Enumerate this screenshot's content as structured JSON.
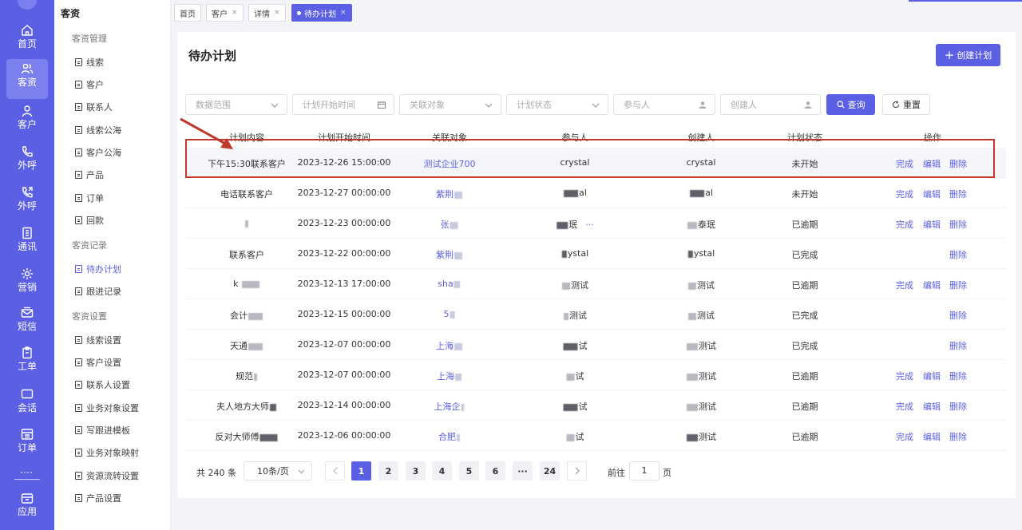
{
  "rail": {
    "items": [
      {
        "label": "首页",
        "icon": "home-icon"
      },
      {
        "label": "客资",
        "icon": "users-icon",
        "active": true
      },
      {
        "label": "客户",
        "icon": "person-icon"
      },
      {
        "label": "外呼",
        "icon": "phone-icon"
      },
      {
        "label": "外呼",
        "icon": "phone-out-icon"
      },
      {
        "label": "通讯",
        "icon": "address-book-icon"
      },
      {
        "label": "营销",
        "icon": "gear-icon"
      },
      {
        "label": "短信",
        "icon": "mail-icon"
      },
      {
        "label": "工单",
        "icon": "clipboard-icon"
      },
      {
        "label": "会话",
        "icon": "chat-icon"
      },
      {
        "label": "订单",
        "icon": "list-icon"
      },
      {
        "label": "应用",
        "icon": "app-icon"
      }
    ],
    "accent": "#5b5fe3"
  },
  "subnav": {
    "title": "客资",
    "groups": [
      {
        "label": "客资管理",
        "items": [
          "线索",
          "客户",
          "联系人",
          "线索公海",
          "客户公海",
          "产品",
          "订单",
          "回款"
        ]
      },
      {
        "label": "客资记录",
        "items": [
          "待办计划",
          "跟进记录"
        ]
      },
      {
        "label": "客资设置",
        "items": [
          "线索设置",
          "客户设置",
          "联系人设置",
          "业务对象设置",
          "写跟进模板",
          "业务对象映射",
          "资源流转设置",
          "产品设置"
        ]
      }
    ],
    "active": "待办计划"
  },
  "tabs": [
    {
      "label": "首页",
      "closable": false
    },
    {
      "label": "客户",
      "closable": true
    },
    {
      "label": "详情",
      "closable": true
    },
    {
      "label": "待办计划",
      "closable": true,
      "active": true
    }
  ],
  "page": {
    "title": "待办计划",
    "create_label": "创建计划"
  },
  "filters": {
    "data_range": "数据范围",
    "start_time": "计划开始时间",
    "related": "关联对象",
    "status": "计划状态",
    "participant": "参与人",
    "creator": "创建人",
    "query_label": "查询",
    "reset_label": "重置"
  },
  "table": {
    "headers": [
      "计划内容",
      "计划开始时间",
      "关联对象",
      "参与人",
      "创建人",
      "计划状态",
      "操作"
    ],
    "rows": [
      {
        "content": "下午15:30联系客户",
        "start": "2023-12-26 15:00:00",
        "related": "测试企业700",
        "participant": "crystal",
        "creator": "crystal",
        "status": "未开始",
        "ops": [
          "完成",
          "编辑",
          "删除"
        ]
      },
      {
        "content": "电话联系客户",
        "start": "2023-12-27 00:00:00",
        "related": "紫荆",
        "participant": "al",
        "creator": "al",
        "status": "未开始",
        "ops": [
          "完成",
          "编辑",
          "删除"
        ]
      },
      {
        "content": "",
        "start": "2023-12-23 00:00:00",
        "related": "张",
        "participant": "珉",
        "creator": "泰珉",
        "status": "已逾期",
        "ops": [
          "完成",
          "编辑",
          "删除"
        ],
        "more": "···"
      },
      {
        "content": "联系客户",
        "start": "2023-12-22 00:00:00",
        "related": "紫荆",
        "participant": "ystal",
        "creator": "ystal",
        "status": "已完成",
        "ops": [
          "删除"
        ]
      },
      {
        "content": "k",
        "start": "2023-12-13 17:00:00",
        "related": "sha",
        "participant": "测试",
        "creator": "测试",
        "status": "已逾期",
        "ops": [
          "完成",
          "编辑",
          "删除"
        ]
      },
      {
        "content": "会计",
        "start": "2023-12-15 00:00:00",
        "related": "5",
        "participant": "测试",
        "creator": "测试",
        "status": "已完成",
        "ops": [
          "删除"
        ]
      },
      {
        "content": "天通",
        "start": "2023-12-07 00:00:00",
        "related": "上海",
        "participant": "试",
        "creator": "测试",
        "status": "已完成",
        "ops": [
          "删除"
        ]
      },
      {
        "content": "规范",
        "start": "2023-12-07 00:00:00",
        "related": "上海",
        "participant": "试",
        "creator": "测试",
        "status": "已逾期",
        "ops": [
          "完成",
          "编辑",
          "删除"
        ]
      },
      {
        "content": "夫人地方大师",
        "start": "2023-12-14 00:00:00",
        "related": "上海企",
        "participant": "试",
        "creator": "测试",
        "status": "已逾期",
        "ops": [
          "完成",
          "编辑",
          "删除"
        ]
      },
      {
        "content": "反对大师傅",
        "start": "2023-12-06 00:00:00",
        "related": "合肥",
        "participant": "试",
        "creator": "测试",
        "status": "已逾期",
        "ops": [
          "完成",
          "编辑",
          "删除"
        ]
      }
    ]
  },
  "pagination": {
    "total_label": "共 240 条",
    "page_size": "10条/页",
    "pages": [
      "1",
      "2",
      "3",
      "4",
      "5",
      "6",
      "···",
      "24"
    ],
    "current": "1",
    "goto_label": "前往",
    "goto_value": "1",
    "goto_suffix": "页"
  },
  "annotation_color": "#c0392b"
}
